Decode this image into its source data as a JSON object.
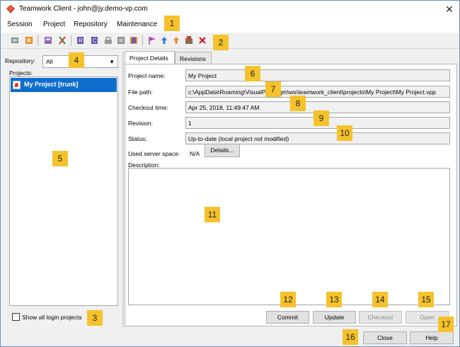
{
  "window": {
    "title": "Teamwork Client - john@jy.demo-vp.com",
    "close_glyph": "✕"
  },
  "menu": [
    "Session",
    "Project",
    "Repository",
    "Maintenance"
  ],
  "toolbar": {
    "icons": [
      "commit-icon",
      "update-icon",
      "checkout-icon",
      "merge-icon",
      "open-icon",
      "new-revision-icon",
      "lock-icon",
      "history-icon",
      "branch-icon",
      "tag-icon",
      "flag-icon",
      "upload-icon",
      "revert-icon",
      "settings-icon",
      "delete-icon"
    ]
  },
  "left": {
    "repository_label": "Repository:",
    "repository_value": "All",
    "projects_label": "Projects:",
    "project_item": "My Project [trunk]",
    "show_all_label": "Show all login projects"
  },
  "tabs": [
    {
      "label": "Project Details",
      "active": true
    },
    {
      "label": "Revisions",
      "active": false
    }
  ],
  "details": {
    "project_name_label": "Project name:",
    "project_name": "My Project",
    "file_path_label": "File path:",
    "file_path": "c:\\AppData\\Roaming\\VisualParadigm\\ws\\teamwork_client\\projects\\My Project\\My Project.vpp",
    "checkout_time_label": "Checkout time:",
    "checkout_time": "Apr 25, 2018, 11:49:47 AM",
    "revision_label": "Revision:",
    "revision": "1",
    "status_label": "Status:",
    "status": "Up-to-date (local project not modified)",
    "server_space_label": "Used server space:",
    "server_space": "N/A",
    "details_button": "Details...",
    "description_label": "Description:"
  },
  "actions": {
    "commit": "Commit",
    "update": "Update",
    "checkout": "Checkout",
    "open": "Open",
    "close": "Close",
    "help": "Help"
  },
  "badges": [
    "1",
    "2",
    "3",
    "4",
    "5",
    "6",
    "7",
    "8",
    "9",
    "10",
    "11",
    "12",
    "13",
    "14",
    "15",
    "16",
    "17"
  ],
  "colors": {
    "selection": "#0f6ecd",
    "badge": "#f6c22b",
    "window_border": "#6b8fb8"
  }
}
